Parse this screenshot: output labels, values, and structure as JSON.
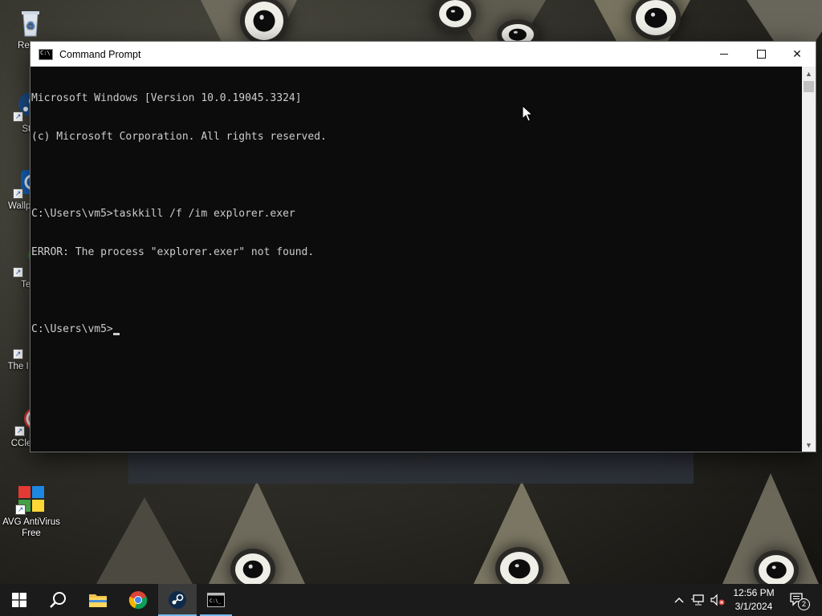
{
  "desktop": {
    "icons": [
      {
        "label": "Recycle Bin",
        "visible_label": "Recyc"
      },
      {
        "label": "Steam",
        "visible_label": "Ste"
      },
      {
        "label": "Wallpaper Engine",
        "visible_label": "Wallp Eng"
      },
      {
        "label": "Terraria",
        "visible_label": "Terr"
      },
      {
        "label": "The Binding of Isaac / Scroll",
        "visible_label": "The I Scro"
      },
      {
        "label": "CCleaner",
        "visible_label": "CCleaner"
      },
      {
        "label": "AVG AntiVirus Free",
        "visible_label": "AVG AntiVirus Free"
      }
    ]
  },
  "window": {
    "title": "Command Prompt",
    "controls": {
      "minimize": "—",
      "maximize": "□",
      "close": "✕"
    },
    "console_lines": [
      "Microsoft Windows [Version 10.0.19045.3324]",
      "(c) Microsoft Corporation. All rights reserved.",
      "",
      "C:\\Users\\vm5>taskkill /f /im explorer.exer",
      "ERROR: The process \"explorer.exer\" not found.",
      "",
      "C:\\Users\\vm5>"
    ],
    "colors": {
      "background": "#0c0c0c",
      "text": "#cccccc",
      "titlebar": "#ffffff"
    }
  },
  "taskbar": {
    "items": [
      {
        "name": "start-button",
        "icon": "windows-logo-icon"
      },
      {
        "name": "search-button",
        "icon": "search-icon"
      },
      {
        "name": "file-explorer",
        "icon": "folder-icon"
      },
      {
        "name": "chrome",
        "icon": "chrome-icon"
      },
      {
        "name": "steam",
        "icon": "steam-icon",
        "state": "active"
      },
      {
        "name": "command-prompt",
        "icon": "cmd-icon",
        "state": "running"
      }
    ],
    "tray": {
      "chevron": "^",
      "clock_time": "12:56 PM",
      "clock_date": "3/1/2024",
      "notification_count": "2"
    }
  }
}
